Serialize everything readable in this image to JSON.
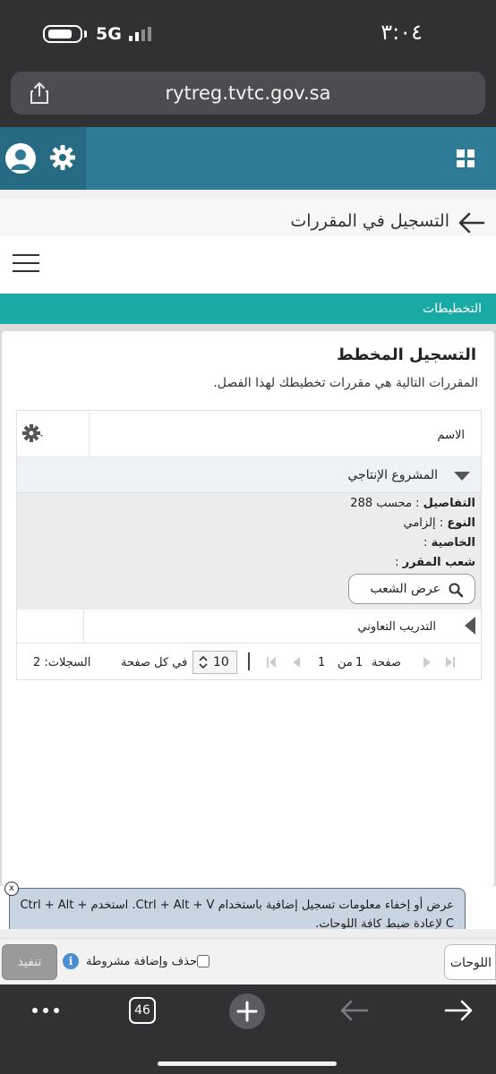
{
  "status_bar": {
    "time": "٣:٠٤",
    "network": "5G"
  },
  "browser": {
    "url": "rytreg.tvtc.gov.sa",
    "tabs_count": "46"
  },
  "page": {
    "title": "التسجيل في المقررات"
  },
  "tabs_bar": {
    "label": "التخطيطات"
  },
  "card": {
    "title": "التسجيل المخطط",
    "subtitle": "المقررات التالية هي مقررات تخطيطك لهذا الفصل."
  },
  "table": {
    "column_header": "الاسم",
    "rows": [
      {
        "title": "المشروع الإنتاجي",
        "details": [
          {
            "label": "التفاصيل",
            "value": "محسب 288"
          },
          {
            "label": "النوع",
            "value": "إلزامي"
          },
          {
            "label": "الخاصية",
            "value": ""
          },
          {
            "label": "شعب المقرر",
            "value": ""
          }
        ],
        "sections_button": "عرض الشعب"
      },
      {
        "title": "التدريب التعاوني"
      }
    ],
    "pager": {
      "page_label": "صفحة",
      "page": "1",
      "of_label": "من",
      "total_pages": "1",
      "per_page": "10",
      "per_page_label": "في كل صفحة",
      "records_label": "السجلات: 2"
    }
  },
  "tooltip": {
    "text": "عرض أو إخفاء معلومات تسجيل إضافية باستخدام Ctrl + Alt + V. استخدم Ctrl + Alt + C لإعادة ضبط كافة اللوحات."
  },
  "bottom_toolbar": {
    "panels_label": "اللوحات",
    "conditional_add_label": "حذف وإضافة مشروطة",
    "execute_label": "تنفيذ"
  },
  "colors": {
    "header": "#2f7b96",
    "teal_tab": "#18aaa4",
    "browser_chrome": "#2f3133"
  }
}
